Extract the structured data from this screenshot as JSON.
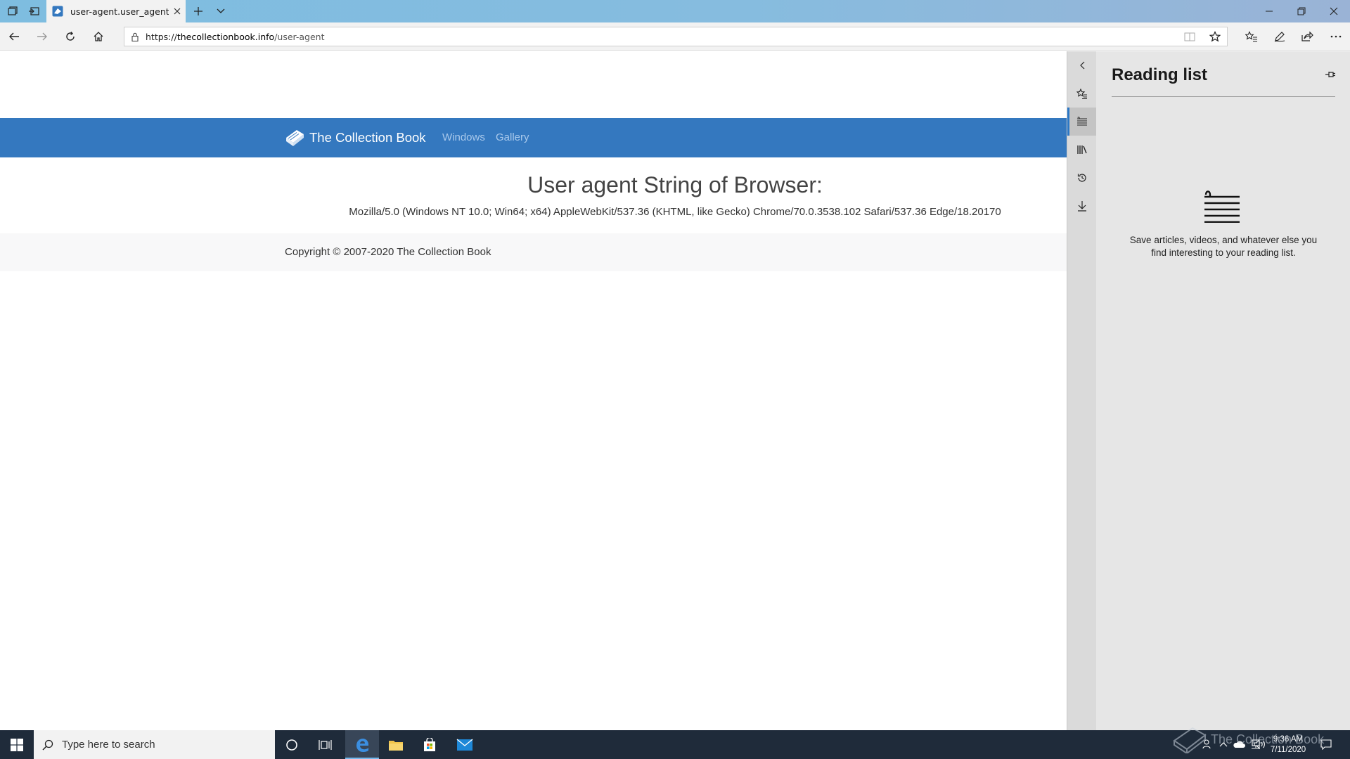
{
  "browser": {
    "tab": {
      "title": "user-agent.user_agent -"
    },
    "address_bar": {
      "scheme": "https://",
      "host": "thecollectionbook.info",
      "path": "/user-agent"
    }
  },
  "site": {
    "brand_name": "The Collection Book",
    "nav": [
      {
        "label": "Windows"
      },
      {
        "label": "Gallery"
      }
    ],
    "heading": "User agent String of Browser:",
    "user_agent_string": "Mozilla/5.0 (Windows NT 10.0; Win64; x64) AppleWebKit/537.36 (KHTML, like Gecko) Chrome/70.0.3538.102 Safari/537.36 Edge/18.20170",
    "footer": "Copyright © 2007-2020 The Collection Book",
    "header_color": "#3478bf"
  },
  "hub": {
    "title": "Reading list",
    "empty_message_line1": "Save articles, videos, and whatever else you",
    "empty_message_line2": "find interesting to your reading list.",
    "accent_color": "#2b78c6"
  },
  "taskbar": {
    "search_placeholder": "Type here to search",
    "time": "9:36 AM",
    "date": "7/11/2020"
  },
  "watermark": {
    "text": "The Collection Book"
  }
}
